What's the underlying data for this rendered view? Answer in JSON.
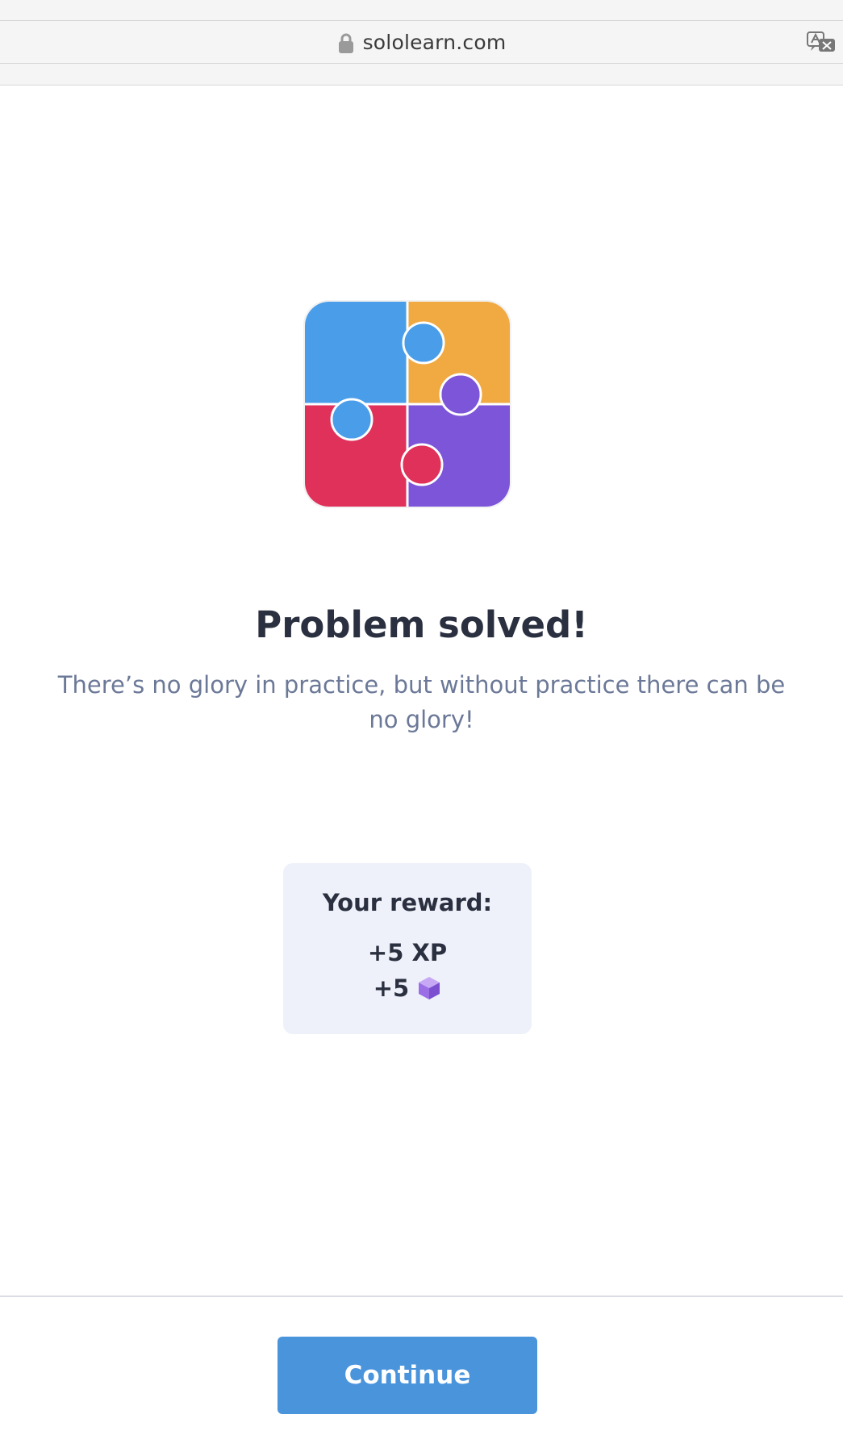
{
  "browser": {
    "url": "sololearn.com",
    "lock_icon": "lock-icon",
    "translate_icon": "translate-icon"
  },
  "hero": {
    "illustration": "puzzle-icon",
    "colors": {
      "blue": "#4a9ee9",
      "orange": "#f1a941",
      "red": "#e0315b",
      "purple": "#7d55d9"
    }
  },
  "message": {
    "title": "Problem solved!",
    "subtitle": "There’s no glory in practice, but without practice there can be no glory!"
  },
  "reward": {
    "label": "Your reward:",
    "xp": "+5 XP",
    "bits": "+5",
    "bits_icon": "bit-cube-icon"
  },
  "footer": {
    "continue_label": "Continue",
    "accent": "#4a94dc"
  }
}
